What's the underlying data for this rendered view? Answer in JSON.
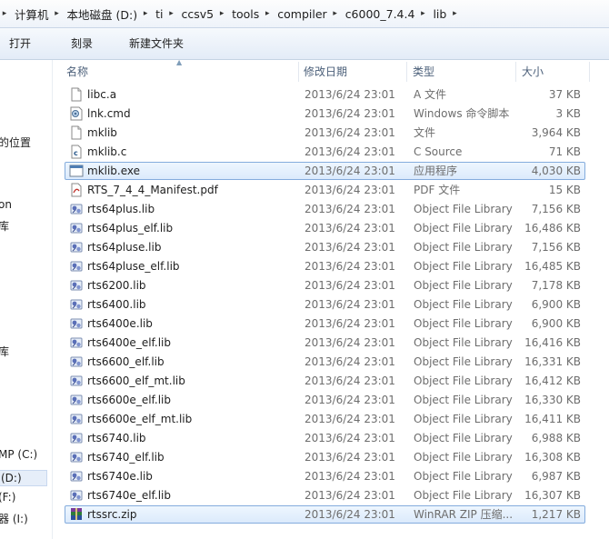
{
  "address": {
    "crumbs": [
      "计算机",
      "本地磁盘 (D:)",
      "ti",
      "ccsv5",
      "tools",
      "compiler",
      "c6000_7.4.4",
      "lib"
    ]
  },
  "toolbar": {
    "open_label": "打开",
    "burn_label": "刻录",
    "new_folder_label": "新建文件夹"
  },
  "nav": {
    "items": [
      "的位置",
      "on",
      "库",
      "库",
      "MP (C:)",
      "(D:)",
      "(F:)",
      "器 (I:)"
    ]
  },
  "columns": {
    "name": "名称",
    "date": "修改日期",
    "type": "类型",
    "size": "大小"
  },
  "files": [
    {
      "name": "libc.a",
      "date": "2013/6/24 23:01",
      "type": "A 文件",
      "size": "37 KB",
      "icon": "blank-file-icon"
    },
    {
      "name": "lnk.cmd",
      "date": "2013/6/24 23:01",
      "type": "Windows 命令脚本",
      "size": "3 KB",
      "icon": "cmd-script-icon"
    },
    {
      "name": "mklib",
      "date": "2013/6/24 23:01",
      "type": "文件",
      "size": "3,964 KB",
      "icon": "blank-file-icon"
    },
    {
      "name": "mklib.c",
      "date": "2013/6/24 23:01",
      "type": "C Source",
      "size": "71 KB",
      "icon": "c-source-icon"
    },
    {
      "name": "mklib.exe",
      "date": "2013/6/24 23:01",
      "type": "应用程序",
      "size": "4,030 KB",
      "icon": "exe-icon",
      "selected": true
    },
    {
      "name": "RTS_7_4_4_Manifest.pdf",
      "date": "2013/6/24 23:01",
      "type": "PDF 文件",
      "size": "15 KB",
      "icon": "pdf-icon"
    },
    {
      "name": "rts64plus.lib",
      "date": "2013/6/24 23:01",
      "type": "Object File Library",
      "size": "7,156 KB",
      "icon": "library-icon"
    },
    {
      "name": "rts64plus_elf.lib",
      "date": "2013/6/24 23:01",
      "type": "Object File Library",
      "size": "16,486 KB",
      "icon": "library-icon"
    },
    {
      "name": "rts64pluse.lib",
      "date": "2013/6/24 23:01",
      "type": "Object File Library",
      "size": "7,156 KB",
      "icon": "library-icon"
    },
    {
      "name": "rts64pluse_elf.lib",
      "date": "2013/6/24 23:01",
      "type": "Object File Library",
      "size": "16,485 KB",
      "icon": "library-icon"
    },
    {
      "name": "rts6200.lib",
      "date": "2013/6/24 23:01",
      "type": "Object File Library",
      "size": "7,178 KB",
      "icon": "library-icon"
    },
    {
      "name": "rts6400.lib",
      "date": "2013/6/24 23:01",
      "type": "Object File Library",
      "size": "6,900 KB",
      "icon": "library-icon"
    },
    {
      "name": "rts6400e.lib",
      "date": "2013/6/24 23:01",
      "type": "Object File Library",
      "size": "6,900 KB",
      "icon": "library-icon"
    },
    {
      "name": "rts6400e_elf.lib",
      "date": "2013/6/24 23:01",
      "type": "Object File Library",
      "size": "16,416 KB",
      "icon": "library-icon"
    },
    {
      "name": "rts6600_elf.lib",
      "date": "2013/6/24 23:01",
      "type": "Object File Library",
      "size": "16,331 KB",
      "icon": "library-icon"
    },
    {
      "name": "rts6600_elf_mt.lib",
      "date": "2013/6/24 23:01",
      "type": "Object File Library",
      "size": "16,412 KB",
      "icon": "library-icon"
    },
    {
      "name": "rts6600e_elf.lib",
      "date": "2013/6/24 23:01",
      "type": "Object File Library",
      "size": "16,330 KB",
      "icon": "library-icon"
    },
    {
      "name": "rts6600e_elf_mt.lib",
      "date": "2013/6/24 23:01",
      "type": "Object File Library",
      "size": "16,411 KB",
      "icon": "library-icon"
    },
    {
      "name": "rts6740.lib",
      "date": "2013/6/24 23:01",
      "type": "Object File Library",
      "size": "6,988 KB",
      "icon": "library-icon"
    },
    {
      "name": "rts6740_elf.lib",
      "date": "2013/6/24 23:01",
      "type": "Object File Library",
      "size": "16,308 KB",
      "icon": "library-icon"
    },
    {
      "name": "rts6740e.lib",
      "date": "2013/6/24 23:01",
      "type": "Object File Library",
      "size": "6,987 KB",
      "icon": "library-icon"
    },
    {
      "name": "rts6740e_elf.lib",
      "date": "2013/6/24 23:01",
      "type": "Object File Library",
      "size": "16,307 KB",
      "icon": "library-icon"
    },
    {
      "name": "rtssrc.zip",
      "date": "2013/6/24 23:01",
      "type": "WinRAR ZIP 压缩...",
      "size": "1,217 KB",
      "icon": "winrar-archive-icon",
      "selected": true
    }
  ]
}
